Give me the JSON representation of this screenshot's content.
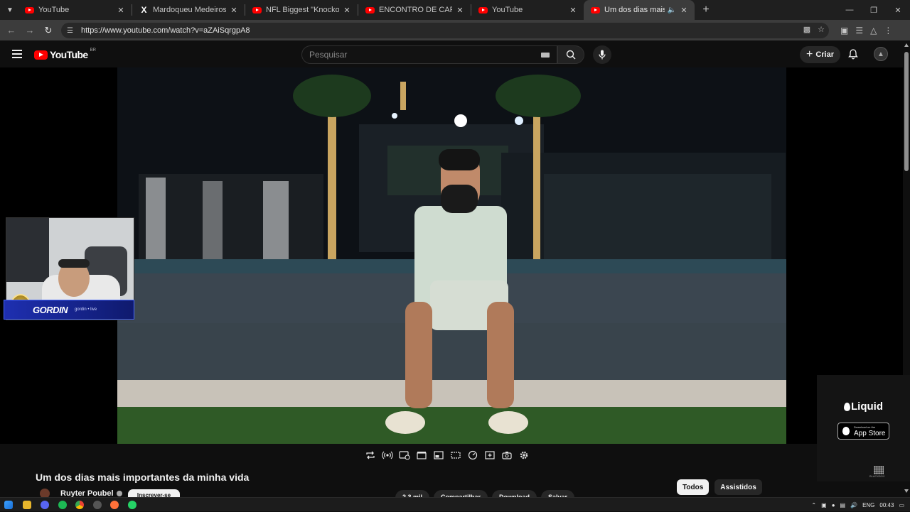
{
  "browser": {
    "tabs": [
      {
        "title": "YouTube",
        "icon": "youtube-favicon",
        "active": false
      },
      {
        "title": "Mardoqueu Medeiros ᴬᴬ no X:",
        "icon": "x-favicon",
        "active": false
      },
      {
        "title": "NFL Biggest \"Knockout Hits\" - Y",
        "icon": "youtube-favicon",
        "active": false
      },
      {
        "title": "ENCONTRO DE CARROS NO EU",
        "icon": "youtube-favicon",
        "active": false
      },
      {
        "title": "YouTube",
        "icon": "youtube-favicon",
        "active": false
      },
      {
        "title": "Um dos dias mais importan",
        "icon": "youtube-favicon",
        "active": true,
        "audio": true
      }
    ],
    "url": "https://www.youtube.com/watch?v=aZAiSqrgpA8"
  },
  "youtube": {
    "logo_text": "YouTube",
    "country": "BR",
    "search_placeholder": "Pesquisar",
    "create_label": "Criar"
  },
  "overlay": {
    "streamer_name": "GORDIN",
    "streamer_sub": "gordin • live"
  },
  "ad": {
    "brand": "Liquid",
    "store_small": "Download on the",
    "store_big": "App Store",
    "network": "BLACKBOX"
  },
  "video": {
    "title": "Um dos dias mais importantes da minha vida",
    "channel": "Ruyter Poubel",
    "subscribe_label": "Inscrever-se",
    "actions": [
      "2,3 mil",
      "Compartilhar",
      "Download",
      "Salvar"
    ]
  },
  "chips": [
    "Todos",
    "Assistidos"
  ],
  "taskbar": {
    "lang": "ENG",
    "time": "00:43"
  },
  "colors": {
    "youtube_red": "#ff0000",
    "background": "#0f0f0f",
    "overlay_blue": "#1e2fb0"
  }
}
